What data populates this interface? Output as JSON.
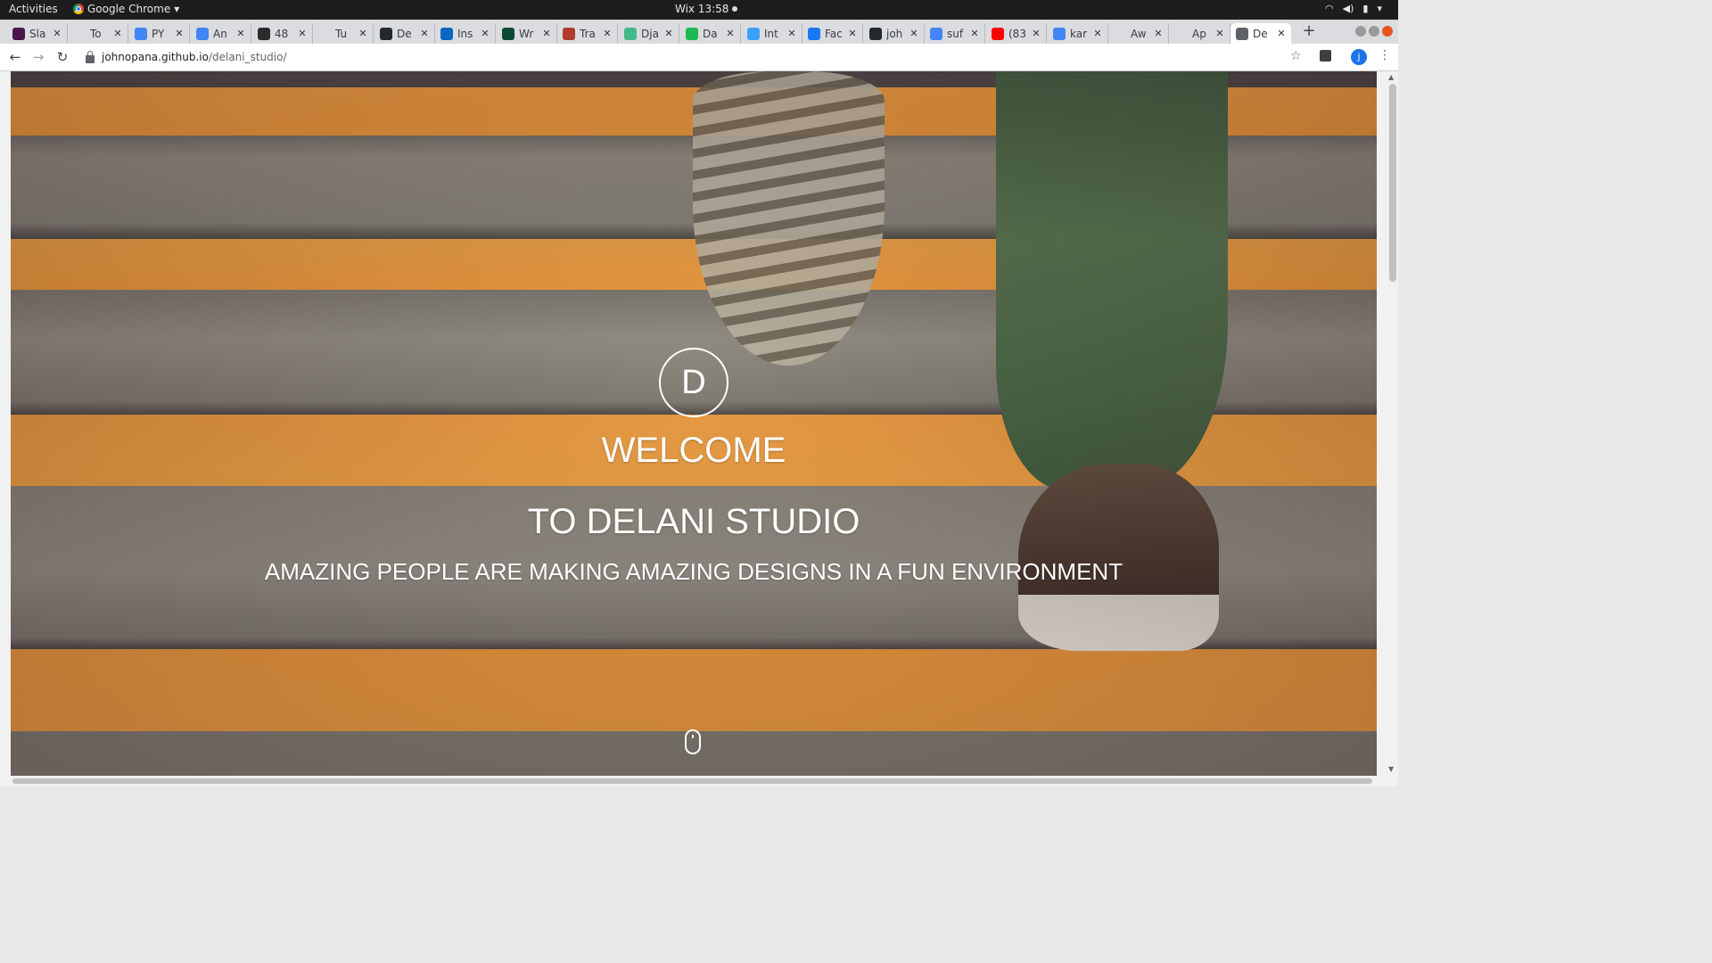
{
  "os_bar": {
    "activities": "Activities",
    "app_name": "Google Chrome",
    "clock": "Wix 13:58"
  },
  "tabs": [
    {
      "label": "Sla",
      "color": "#4a154b"
    },
    {
      "label": "To",
      "color": "#dadcdf"
    },
    {
      "label": "PY",
      "color": "#4285f4"
    },
    {
      "label": "An",
      "color": "#4285f4"
    },
    {
      "label": "48",
      "color": "#2b2b2b"
    },
    {
      "label": "Tu",
      "color": "#dadcdf"
    },
    {
      "label": "De",
      "color": "#24292e"
    },
    {
      "label": "Ins",
      "color": "#0a66c2"
    },
    {
      "label": "Wr",
      "color": "#0c4b33"
    },
    {
      "label": "Tra",
      "color": "#b03a2e"
    },
    {
      "label": "Dja",
      "color": "#44b78b"
    },
    {
      "label": "Da",
      "color": "#1db954"
    },
    {
      "label": "Int",
      "color": "#3aa0ff"
    },
    {
      "label": "Fac",
      "color": "#1877f2"
    },
    {
      "label": "joh",
      "color": "#24292e"
    },
    {
      "label": "suf",
      "color": "#4285f4"
    },
    {
      "label": "(83",
      "color": "#ff0000"
    },
    {
      "label": "kar",
      "color": "#4285f4"
    },
    {
      "label": "Aw",
      "color": "#dadcdf"
    },
    {
      "label": "Ap",
      "color": "#dadcdf"
    },
    {
      "label": "De",
      "color": "#5f6368"
    }
  ],
  "active_tab_index": 20,
  "address_bar": {
    "host": "johnopana.github.io",
    "path": "/delani_studio/"
  },
  "profile_initial": "j",
  "hero": {
    "logo_letter": "D",
    "welcome": "WELCOME",
    "studio": "TO DELANI STUDIO",
    "tagline": "AMAZING PEOPLE ARE MAKING AMAZING DESIGNS IN A FUN ENVIRONMENT"
  },
  "icons": {
    "back": "arrow-left-icon",
    "forward": "arrow-right-icon",
    "reload": "reload-icon",
    "bookmark": "star-icon",
    "scroll_hint": "mouse-scroll-icon"
  }
}
